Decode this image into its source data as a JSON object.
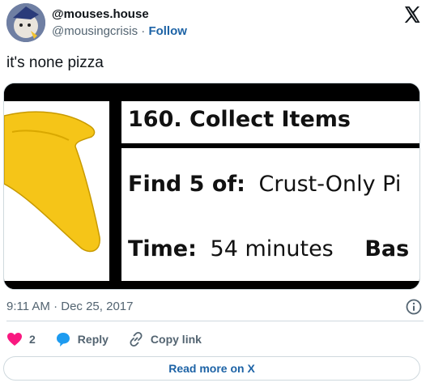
{
  "author": {
    "display_name": "@mouses.house",
    "handle": "@mousingcrisis",
    "separator": "·",
    "follow_label": "Follow"
  },
  "tweet": {
    "text": "it's none pizza",
    "timestamp": "9:11 AM · Dec 25, 2017"
  },
  "media": {
    "title": "160. Collect Items",
    "find_label": "Find 5 of:",
    "find_value": "Crust-Only Pi",
    "time_label": "Time:",
    "time_value": "54 minutes",
    "extra_label": "Bas"
  },
  "actions": {
    "like_count": "2",
    "reply_label": "Reply",
    "copy_link_label": "Copy link"
  },
  "read_more_label": "Read more on X",
  "colors": {
    "like": "#f91880",
    "reply": "#1d9bf0",
    "link": "#1d63a6",
    "muted": "#536471"
  }
}
